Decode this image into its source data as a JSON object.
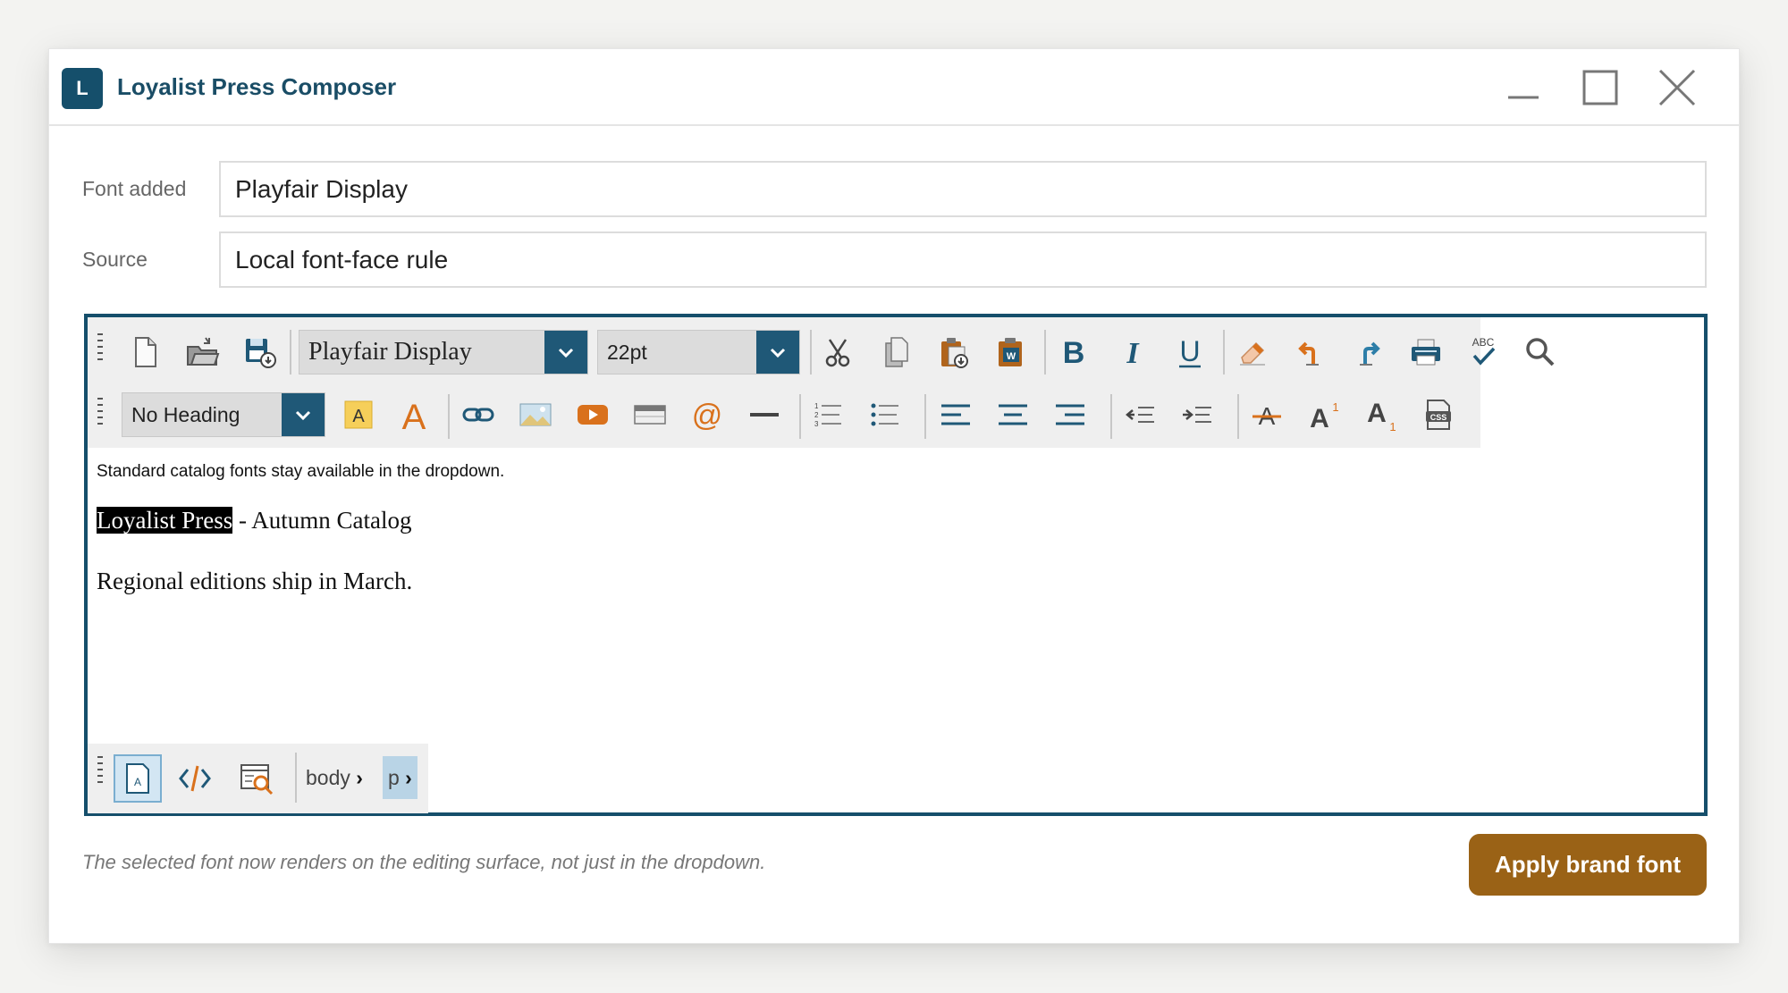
{
  "window": {
    "title": "Loyalist Press Composer",
    "app_icon_letter": "L"
  },
  "fields": [
    {
      "label": "Font added",
      "value": "Playfair Display"
    },
    {
      "label": "Source",
      "value": "Local font-face rule"
    }
  ],
  "toolbar": {
    "font_family": "Playfair Display",
    "font_size": "22pt",
    "heading": "No Heading",
    "highlight_glyph": "A",
    "text_color_glyph": "A",
    "spellcheck_label": "ABC",
    "css_label": "CSS"
  },
  "content": {
    "note": "Standard catalog fonts stay available in the dropdown.",
    "line1_selected": "Loyalist Press",
    "line1_rest": " - Autumn Catalog",
    "line2": "Regional editions ship in March."
  },
  "statusbar": {
    "crumbs": [
      "body",
      "p"
    ]
  },
  "footer": {
    "note": "The selected font now renders on the editing surface, not just in the dropdown.",
    "apply_label": "Apply brand font"
  },
  "colors": {
    "accent": "#154f6b",
    "button": "#9a6216",
    "icon_orange": "#d9711c",
    "icon_blue": "#1f5877"
  }
}
